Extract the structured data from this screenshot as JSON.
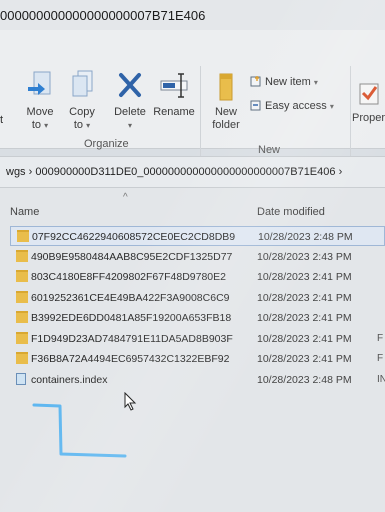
{
  "window": {
    "title": "000000000000000000007B71E406"
  },
  "ribbon": {
    "partial_left_label": "t",
    "organize": {
      "group_label": "Organize",
      "move_to": {
        "line1": "Move",
        "line2": "to",
        "icon": "move-to-icon"
      },
      "copy_to": {
        "line1": "Copy",
        "line2": "to",
        "icon": "copy-to-icon"
      },
      "delete": {
        "label": "Delete",
        "icon": "delete-x-icon"
      },
      "rename": {
        "label": "Rename",
        "icon": "rename-icon"
      }
    },
    "new": {
      "group_label": "New",
      "new_folder": {
        "line1": "New",
        "line2": "folder",
        "icon": "new-folder-icon"
      },
      "new_item": "New item",
      "easy_access": "Easy access"
    },
    "open": {
      "properties": "Properti",
      "icon": "properties-checkmark-icon"
    }
  },
  "address": {
    "segments": [
      "wgs",
      "000900000D311DE0_000000000000000000000007B71E406"
    ]
  },
  "columns": {
    "name": "Name",
    "date_modified": "Date modified"
  },
  "files": [
    {
      "name": "07F92CC4622940608572CE0EC2CD8DB9",
      "date": "10/28/2023 2:48 PM",
      "kind": "folder",
      "type": "",
      "selected": true
    },
    {
      "name": "490B9E9580484AAB8C95E2CDF1325D77",
      "date": "10/28/2023 2:43 PM",
      "kind": "folder",
      "type": ""
    },
    {
      "name": "803C4180E8FF4209802F67F48D9780E2",
      "date": "10/28/2023 2:41 PM",
      "kind": "folder",
      "type": ""
    },
    {
      "name": "6019252361CE4E49BA422F3A9008C6C9",
      "date": "10/28/2023 2:41 PM",
      "kind": "folder",
      "type": ""
    },
    {
      "name": "B3992EDE6DD0481A85F19200A653FB18",
      "date": "10/28/2023 2:41 PM",
      "kind": "folder",
      "type": ""
    },
    {
      "name": "F1D949D23AD7484791E11DA5AD8B903F",
      "date": "10/28/2023 2:41 PM",
      "kind": "folder",
      "type": "F"
    },
    {
      "name": "F36B8A72A4494EC6957432C1322EBF92",
      "date": "10/28/2023 2:41 PM",
      "kind": "folder",
      "type": "F"
    },
    {
      "name": "containers.index",
      "date": "10/28/2023 2:48 PM",
      "kind": "file",
      "type": "IN"
    }
  ],
  "colors": {
    "folder": "#e9bd4b",
    "delete_x": "#2f63a8",
    "marker": "#5fb7f0",
    "check": "#d9532c"
  }
}
